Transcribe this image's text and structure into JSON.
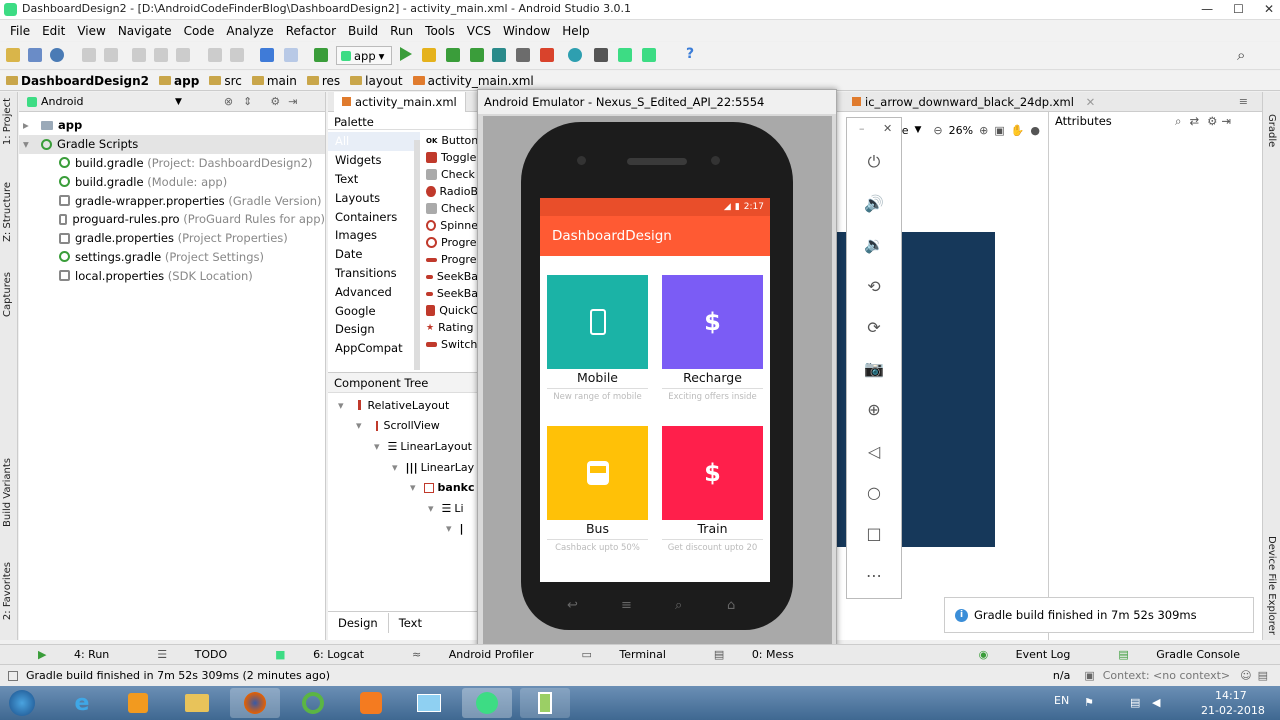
{
  "window": {
    "title": "DashboardDesign2 - [D:\\AndroidCodeFinderBlog\\DashboardDesign2] - activity_main.xml - Android Studio 3.0.1"
  },
  "menu": [
    "File",
    "Edit",
    "View",
    "Navigate",
    "Code",
    "Analyze",
    "Refactor",
    "Build",
    "Run",
    "Tools",
    "VCS",
    "Window",
    "Help"
  ],
  "toolbar": {
    "run_config": "app"
  },
  "breadcrumbs": [
    "DashboardDesign2",
    "app",
    "src",
    "main",
    "res",
    "layout",
    "activity_main.xml"
  ],
  "left_strip": [
    "1: Project",
    "Z: Structure",
    "Captures",
    "Build Variants",
    "2: Favorites"
  ],
  "right_strip": [
    "Gradle",
    "Device File Explorer"
  ],
  "project": {
    "view": "Android",
    "items": [
      {
        "label": "app",
        "note": "",
        "indent": 0,
        "icon": "folder"
      },
      {
        "label": "Gradle Scripts",
        "note": "",
        "indent": 0,
        "icon": "gradle"
      },
      {
        "label": "build.gradle",
        "note": "(Project: DashboardDesign2)",
        "indent": 1,
        "icon": "gradle"
      },
      {
        "label": "build.gradle",
        "note": "(Module: app)",
        "indent": 1,
        "icon": "gradle"
      },
      {
        "label": "gradle-wrapper.properties",
        "note": "(Gradle Version)",
        "indent": 1,
        "icon": "file"
      },
      {
        "label": "proguard-rules.pro",
        "note": "(ProGuard Rules for app)",
        "indent": 1,
        "icon": "file"
      },
      {
        "label": "gradle.properties",
        "note": "(Project Properties)",
        "indent": 1,
        "icon": "file"
      },
      {
        "label": "settings.gradle",
        "note": "(Project Settings)",
        "indent": 1,
        "icon": "gradle"
      },
      {
        "label": "local.properties",
        "note": "(SDK Location)",
        "indent": 1,
        "icon": "file"
      }
    ]
  },
  "editor": {
    "tabs": [
      "activity_main.xml",
      "ic_arrow_downward_black_24dp.xml"
    ],
    "palette_title": "Palette",
    "palette_categories": [
      "All",
      "Widgets",
      "Text",
      "Layouts",
      "Containers",
      "Images",
      "Date",
      "Transitions",
      "Advanced",
      "Google",
      "Design",
      "AppCompat"
    ],
    "palette_items": [
      "Button",
      "Toggle",
      "Check",
      "RadioB",
      "Check",
      "Spinne",
      "Progre",
      "Progre",
      "SeekBa",
      "SeekBa",
      "QuickC",
      "Rating",
      "Switch"
    ],
    "component_tree_title": "Component Tree",
    "component_tree": [
      {
        "label": "RelativeLayout",
        "depth": 0
      },
      {
        "label": "ScrollView",
        "depth": 1
      },
      {
        "label": "LinearLayout",
        "depth": 2
      },
      {
        "label": "LinearLay",
        "depth": 3
      },
      {
        "label": "bankc",
        "depth": 4
      },
      {
        "label": "Li",
        "depth": 5
      }
    ],
    "design_tab": "Design",
    "text_tab": "Text",
    "zoom": "26%",
    "page_label": "age",
    "attributes_title": "Attributes"
  },
  "emulator": {
    "title": "Android Emulator - Nexus_S_Edited_API_22:5554",
    "time": "2:17",
    "app_title": "DashboardDesign",
    "cards": [
      {
        "title": "Mobile",
        "subtitle": "New range of mobile",
        "color": "#1bb3a6",
        "icon": "phone-icon"
      },
      {
        "title": "Recharge",
        "subtitle": "Exciting offers inside",
        "color": "#7b5cf5",
        "icon": "dollar-icon"
      },
      {
        "title": "Bus",
        "subtitle": "Cashback upto 50%",
        "color": "#ffc107",
        "icon": "bus-icon"
      },
      {
        "title": "Train",
        "subtitle": "Get discount upto 20",
        "color": "#ff1f4b",
        "icon": "dollar-icon"
      }
    ]
  },
  "notification": {
    "text": "Gradle build finished in 7m 52s 309ms"
  },
  "bottom_tabs": [
    "4: Run",
    "TODO",
    "6: Logcat",
    "Android Profiler",
    "Terminal",
    "0: Mess"
  ],
  "bottom_right_tabs": [
    "Event Log",
    "Gradle Console"
  ],
  "status": {
    "text": "Gradle build finished in 7m 52s 309ms (2 minutes ago)",
    "na": "n/a",
    "context": "Context: <no context>"
  },
  "taskbar": {
    "lang": "EN",
    "time": "14:17",
    "date": "21-02-2018"
  }
}
